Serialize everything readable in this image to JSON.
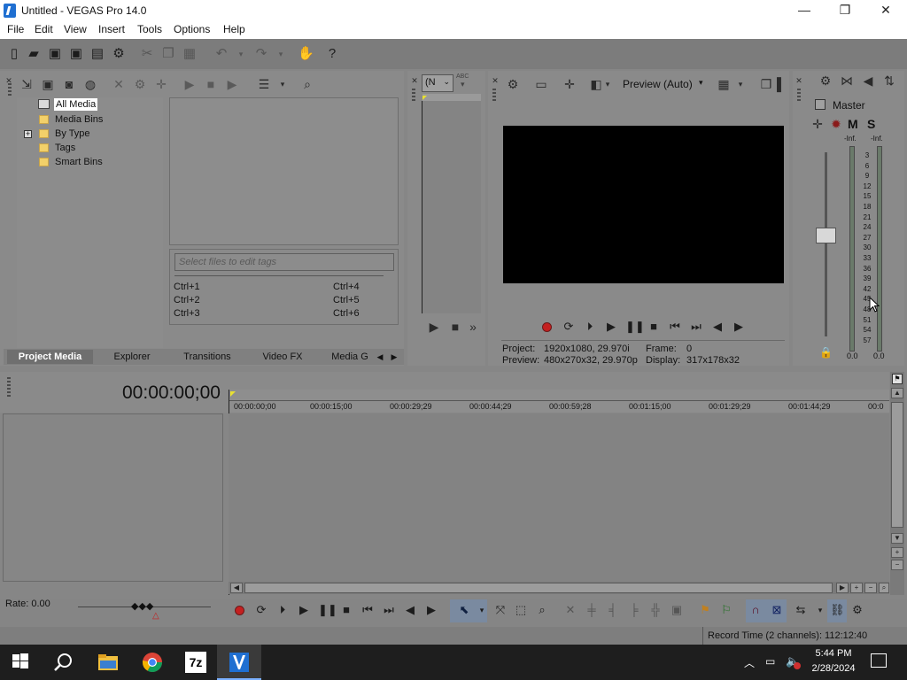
{
  "window": {
    "title": "Untitled - VEGAS Pro 14.0",
    "minimize": "—",
    "maximize": "❐",
    "close": "✕"
  },
  "menu": [
    "File",
    "Edit",
    "View",
    "Insert",
    "Tools",
    "Options",
    "Help"
  ],
  "explorer": {
    "tree": [
      {
        "label": "All Media",
        "selected": true
      },
      {
        "label": "Media Bins"
      },
      {
        "label": "By Type",
        "expander": "+"
      },
      {
        "label": "Tags"
      },
      {
        "label": "Smart Bins"
      }
    ],
    "tag_placeholder": "Select files to edit tags",
    "shortcuts": [
      "Ctrl+1",
      "Ctrl+4",
      "Ctrl+2",
      "Ctrl+5",
      "Ctrl+3",
      "Ctrl+6"
    ]
  },
  "tabs": [
    "Project Media",
    "Explorer",
    "Transitions",
    "Video FX",
    "Media G"
  ],
  "trimmer": {
    "dropdown": "(N",
    "abc": "ABC"
  },
  "preview": {
    "mode": "Preview (Auto)",
    "project_label": "Project:",
    "project_value": "1920x1080, 29.970i",
    "preview_label": "Preview:",
    "preview_value": "480x270x32, 29.970p",
    "frame_label": "Frame:",
    "frame_value": "0",
    "display_label": "Display:",
    "display_value": "317x178x32"
  },
  "mixer": {
    "label": "Master",
    "m": "M",
    "s": "S",
    "left_peak": "-Inf.",
    "right_peak": "-Inf.",
    "scale": [
      "3",
      "6",
      "9",
      "12",
      "15",
      "18",
      "21",
      "24",
      "27",
      "30",
      "33",
      "36",
      "39",
      "42",
      "45",
      "48",
      "51",
      "54",
      "57"
    ],
    "left_value": "0.0",
    "right_value": "0.0",
    "fader_level": 0.55
  },
  "timeline": {
    "timecode": "00:00:00;00",
    "ruler": [
      "00:00:00;00",
      "00:00:15;00",
      "00:00:29;29",
      "00:00:44;29",
      "00:00:59;28",
      "00:01:15;00",
      "00:01:29;29",
      "00:01:44;29",
      "00:0"
    ],
    "rate": "Rate: 0.00"
  },
  "status": {
    "record_time": "Record Time (2 channels): 112:12:40"
  },
  "taskbar": {
    "time": "5:44 PM",
    "date": "2/28/2024",
    "z7": "7z"
  },
  "colors": {
    "accent": "#1f6fd1",
    "panel": "#8a8a8a",
    "active_tab": "#6f6f6f",
    "record": "#c42020"
  }
}
